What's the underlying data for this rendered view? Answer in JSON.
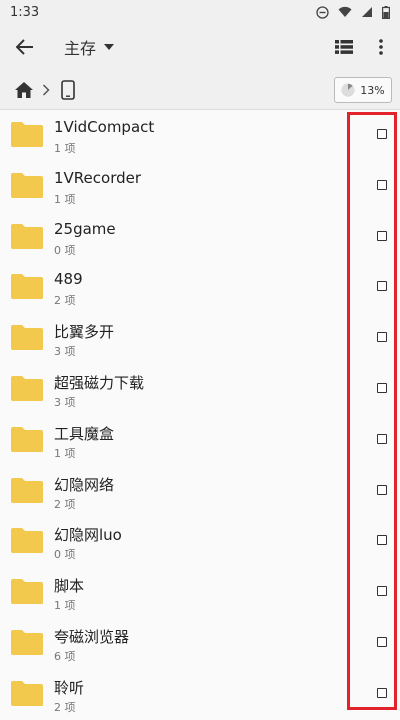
{
  "status_bar": {
    "time": "1:33"
  },
  "app_bar": {
    "title": "主存"
  },
  "storage": {
    "percent": "13%",
    "used_fraction": 0.13
  },
  "files": [
    {
      "name": "1VidCompact",
      "meta": "1 项"
    },
    {
      "name": "1VRecorder",
      "meta": "1 项"
    },
    {
      "name": "25game",
      "meta": "0 项"
    },
    {
      "name": "489",
      "meta": "2 项"
    },
    {
      "name": "比翼多开",
      "meta": "3 项"
    },
    {
      "name": "超强磁力下载",
      "meta": "3 项"
    },
    {
      "name": "工具魔盒",
      "meta": "1 项"
    },
    {
      "name": "幻隐网络",
      "meta": "2 项"
    },
    {
      "name": "幻隐网luo",
      "meta": "0 项"
    },
    {
      "name": "脚本",
      "meta": "1 项"
    },
    {
      "name": "夸磁浏览器",
      "meta": "6 项"
    },
    {
      "name": "聆听",
      "meta": "2 项"
    }
  ],
  "colors": {
    "folder": "#f2c94c",
    "highlight": "#e3232b"
  }
}
